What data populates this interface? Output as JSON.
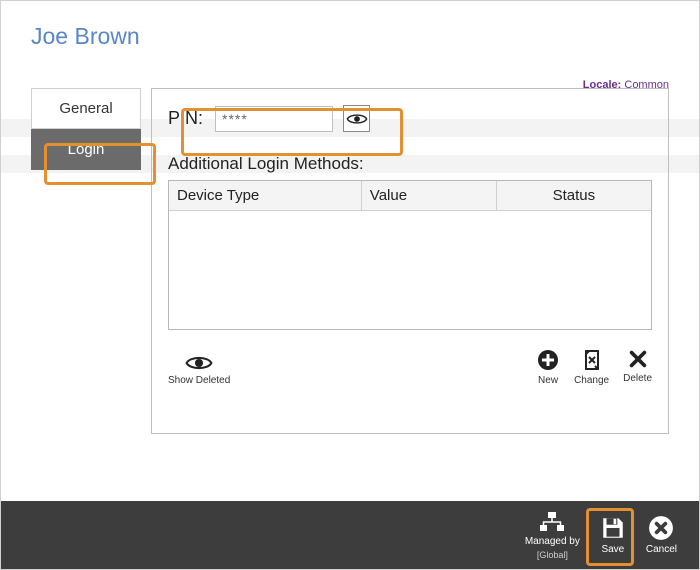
{
  "title": "Joe Brown",
  "locale": {
    "label": "Locale:",
    "value": "Common"
  },
  "tabs": {
    "general": "General",
    "login": "Login"
  },
  "pin": {
    "label": "PIN:",
    "value": "****"
  },
  "additional": {
    "label": "Additional Login Methods:"
  },
  "columns": {
    "device_type": "Device Type",
    "value": "Value",
    "status": "Status"
  },
  "panel_footer": {
    "show_deleted": "Show Deleted",
    "new": "New",
    "change": "Change",
    "delete": "Delete"
  },
  "bar": {
    "managed_by": "Managed by",
    "managed_by_sub": "[Global]",
    "save": "Save",
    "cancel": "Cancel"
  }
}
